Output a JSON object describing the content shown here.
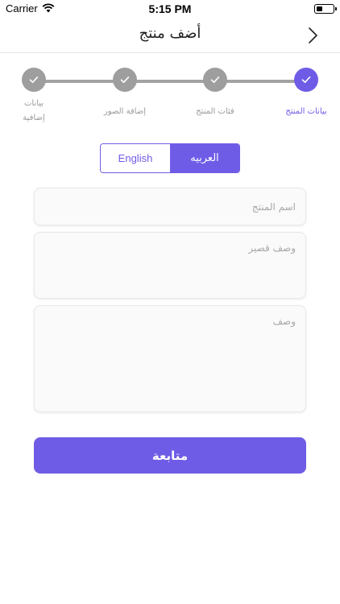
{
  "status_bar": {
    "carrier": "Carrier",
    "time": "5:15 PM"
  },
  "navbar": {
    "title": "أضف منتج",
    "back_icon": "chevron-right-icon"
  },
  "stepper": {
    "steps": [
      {
        "label": "بيانات المنتج",
        "state": "active"
      },
      {
        "label": "فئات المنتج",
        "state": "done"
      },
      {
        "label": "إضافة الصور",
        "state": "done"
      },
      {
        "label_line1": "بيانات",
        "label_line2": "إضافية",
        "state": "done"
      }
    ],
    "check_icon": "check-icon"
  },
  "language_toggle": {
    "english": "English",
    "arabic": "العربيه",
    "selected": "arabic"
  },
  "form": {
    "product_name_placeholder": "اسم المنتج",
    "short_description_placeholder": "وصف قصير",
    "description_placeholder": "وصف"
  },
  "continue_label": "متابعة",
  "colors": {
    "accent": "#6f5ce6",
    "step_inactive": "#9e9e9e",
    "line": "#a3a3a3"
  }
}
